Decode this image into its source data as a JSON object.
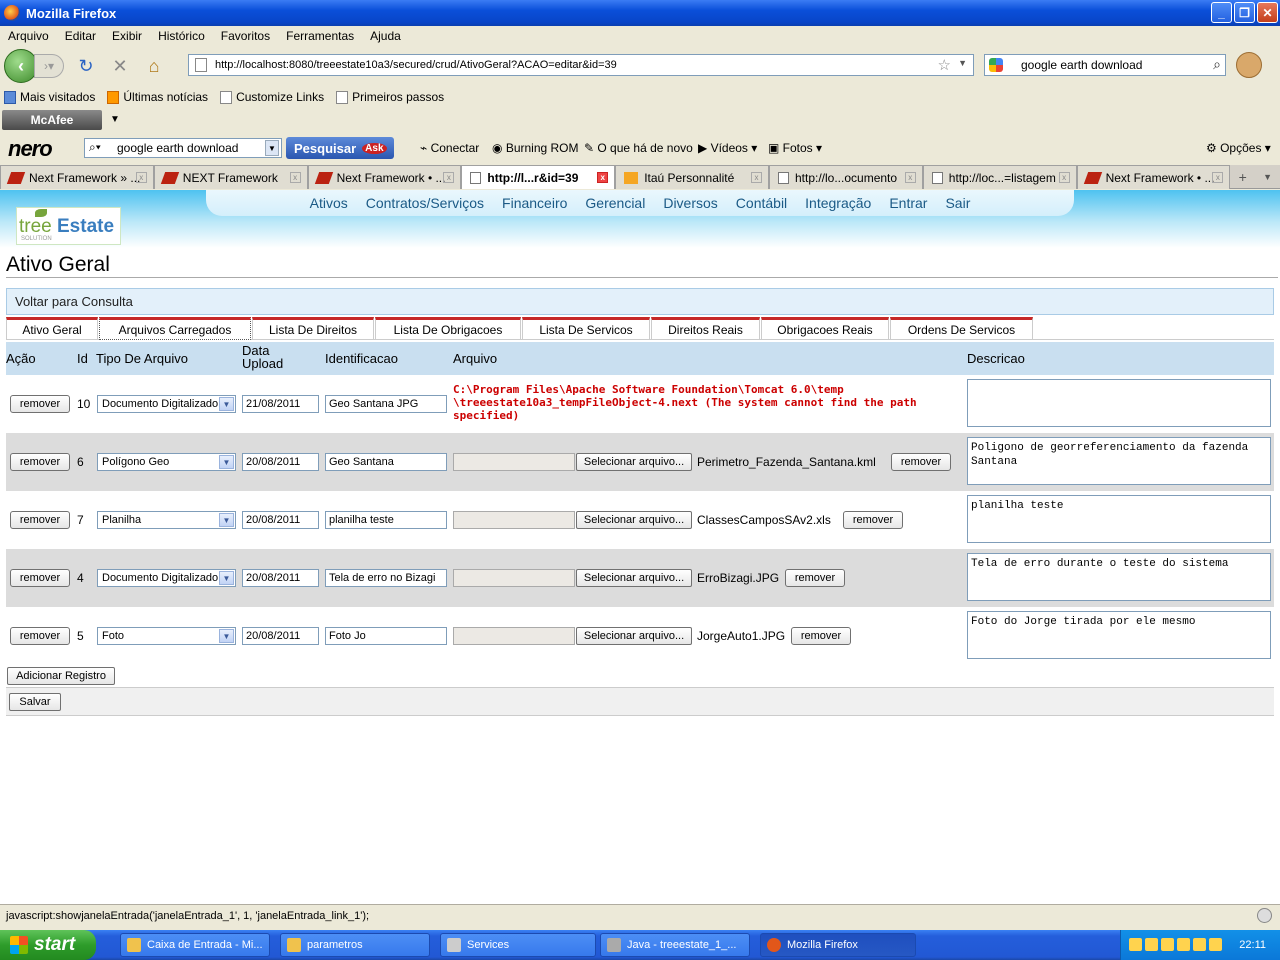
{
  "window": {
    "title": "Mozilla Firefox"
  },
  "menu": [
    "Arquivo",
    "Editar",
    "Exibir",
    "Histórico",
    "Favoritos",
    "Ferramentas",
    "Ajuda"
  ],
  "nav": {
    "url": "http://localhost:8080/treeestate10a3/secured/crud/AtivoGeral?ACAO=editar&id=39",
    "search": "google earth download"
  },
  "bookmarks": [
    "Mais visitados",
    "Últimas notícias",
    "Customize Links",
    "Primeiros passos"
  ],
  "mcafee": "McAfee",
  "nero": {
    "logo": "nero",
    "search": "google earth download",
    "pesquisar": "Pesquisar",
    "items": [
      "Conectar",
      "Burning ROM",
      "O que há de novo",
      "Vídeos",
      "Fotos",
      "Opções"
    ]
  },
  "browser_tabs": [
    "Next Framework » ...",
    "NEXT Framework",
    "Next Framework • ...",
    "http://l...r&id=39",
    "Itaú Personnalité",
    "http://lo...ocumento",
    "http://loc...=listagem",
    "Next Framework • ..."
  ],
  "site_menu": [
    "Ativos",
    "Contratos/Serviços",
    "Financeiro",
    "Gerencial",
    "Diversos",
    "Contábil",
    "Integração",
    "Entrar",
    "Sair"
  ],
  "logo": {
    "tree": "tree",
    "estate": "Estate",
    "sub": "SOLUTION"
  },
  "page_title": "Ativo Geral",
  "voltar": "Voltar para Consulta",
  "content_tabs": [
    "Ativo Geral",
    "Arquivos Carregados",
    "Lista De Direitos",
    "Lista De Obrigacoes",
    "Lista De Servicos",
    "Direitos Reais",
    "Obrigacoes Reais",
    "Ordens De Servicos"
  ],
  "grid": {
    "headers": {
      "acao": "Ação",
      "id": "Id",
      "tipo": "Tipo De Arquivo",
      "data": "Data Upload",
      "ident": "Identificacao",
      "arquivo": "Arquivo",
      "descricao": "Descricao"
    },
    "remove_label": "remover",
    "select_file_label": "Selecionar arquivo...",
    "error_text": "C:\\Program Files\\Apache Software Foundation\\Tomcat 6.0\\temp \\treeestate10a3_tempFileObject-4.next (The system cannot find the path specified)",
    "rows": [
      {
        "id": "10",
        "tipo": "Documento Digitalizado",
        "data": "21/08/2011",
        "ident": "Geo Santana JPG",
        "file": "",
        "descricao": ""
      },
      {
        "id": "6",
        "tipo": "Polígono Geo",
        "data": "20/08/2011",
        "ident": "Geo Santana",
        "file": "Perimetro_Fazenda_Santana.kml",
        "descricao": "Poligono de georreferenciamento da fazenda Santana"
      },
      {
        "id": "7",
        "tipo": "Planilha",
        "data": "20/08/2011",
        "ident": "planilha teste",
        "file": "ClassesCamposSAv2.xls",
        "descricao": "planilha teste"
      },
      {
        "id": "4",
        "tipo": "Documento Digitalizado",
        "data": "20/08/2011",
        "ident": "Tela de erro no Bizagi",
        "file": "ErroBizagi.JPG",
        "descricao": "Tela de erro durante o teste do sistema"
      },
      {
        "id": "5",
        "tipo": "Foto",
        "data": "20/08/2011",
        "ident": "Foto Jo",
        "file": "JorgeAuto1.JPG",
        "descricao": "Foto do Jorge tirada por ele mesmo"
      }
    ]
  },
  "add_label": "Adicionar Registro",
  "save_label": "Salvar",
  "status": "javascript:showjanelaEntrada('janelaEntrada_1', 1, 'janelaEntrada_link_1');",
  "taskbar": {
    "start": "start",
    "items": [
      "Caixa de Entrada - Mi...",
      "parametros",
      "Services",
      "Java - treeestate_1_...",
      "Mozilla Firefox"
    ],
    "clock": "22:11"
  }
}
